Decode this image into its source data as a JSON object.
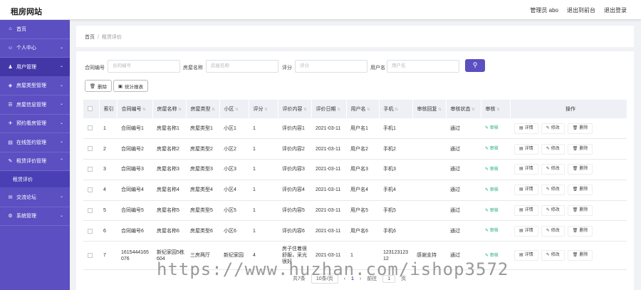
{
  "header": {
    "brand": "租房网站",
    "user_label": "管理员 abo",
    "front_link": "退出到前台",
    "logout_link": "退出登录"
  },
  "sidebar": {
    "items": [
      {
        "icon": "home-icon",
        "glyph": "⌂",
        "label": "首页",
        "chev": ""
      },
      {
        "icon": "person-icon",
        "glyph": "☺",
        "label": "个人中心",
        "chev": "⌄"
      },
      {
        "icon": "user-icon",
        "glyph": "♟",
        "label": "用户管理",
        "chev": "⌄"
      },
      {
        "icon": "category-icon",
        "glyph": "◈",
        "label": "房屋类型管理",
        "chev": "⌄"
      },
      {
        "icon": "list-icon",
        "glyph": "☰",
        "label": "房屋信息管理",
        "chev": "⌄"
      },
      {
        "icon": "appointment-icon",
        "glyph": "✈",
        "label": "预约看房管理",
        "chev": "⌄"
      },
      {
        "icon": "contract-icon",
        "glyph": "▤",
        "label": "在线签约管理",
        "chev": "⌄"
      },
      {
        "icon": "review-icon",
        "glyph": "✎",
        "label": "租赁评价管理",
        "chev": "⌃"
      },
      {
        "icon": "forum-icon",
        "glyph": "✉",
        "label": "交流论坛",
        "chev": "⌄"
      },
      {
        "icon": "system-icon",
        "glyph": "⚙",
        "label": "系统管理",
        "chev": "⌄"
      }
    ],
    "sub_item": "租赁评价"
  },
  "breadcrumb": {
    "home": "首页",
    "sep": "/",
    "current": "租赁评价"
  },
  "search": {
    "contract_label": "合同编号",
    "contract_placeholder": "合同编号",
    "house_label": "房屋名称",
    "house_placeholder": "房屋名称",
    "score_label": "评分",
    "score_placeholder": "评分",
    "user_label": "用户名",
    "user_placeholder": "用户名"
  },
  "toolbar": {
    "delete_label": "删除",
    "stats_label": "统计报表"
  },
  "table": {
    "headers": [
      "索引",
      "合同编号",
      "房屋名称",
      "房屋类型",
      "小区",
      "评分",
      "评价内容",
      "评价日期",
      "用户名",
      "手机",
      "审核回复",
      "审核状态",
      "审核",
      "操作"
    ],
    "audit_label": "审核",
    "op_detail": "详情",
    "op_edit": "修改",
    "op_delete": "删除",
    "rows": [
      [
        "1",
        "合同编号1",
        "房屋名称1",
        "房屋类型1",
        "小区1",
        "1",
        "评价内容1",
        "2021-03-11",
        "用户名1",
        "手机1",
        "",
        "通过"
      ],
      [
        "2",
        "合同编号2",
        "房屋名称2",
        "房屋类型2",
        "小区2",
        "1",
        "评价内容2",
        "2021-03-11",
        "用户名2",
        "手机2",
        "",
        "通过"
      ],
      [
        "3",
        "合同编号3",
        "房屋名称3",
        "房屋类型3",
        "小区3",
        "1",
        "评价内容3",
        "2021-03-11",
        "用户名3",
        "手机3",
        "",
        "通过"
      ],
      [
        "4",
        "合同编号4",
        "房屋名称4",
        "房屋类型4",
        "小区4",
        "1",
        "评价内容4",
        "2021-03-11",
        "用户名4",
        "手机4",
        "",
        "通过"
      ],
      [
        "5",
        "合同编号5",
        "房屋名称5",
        "房屋类型5",
        "小区5",
        "1",
        "评价内容5",
        "2021-03-11",
        "用户名5",
        "手机5",
        "",
        "通过"
      ],
      [
        "6",
        "合同编号6",
        "房屋名称6",
        "房屋类型6",
        "小区6",
        "1",
        "评价内容6",
        "2021-03-11",
        "用户名6",
        "手机6",
        "",
        "通过"
      ],
      [
        "7",
        "1615444165076",
        "新纪家园5栋604",
        "三房两厅",
        "新纪家园",
        "4",
        "房子住着很舒服，采光很好",
        "2021-03-11",
        "1",
        "12312312312",
        "感谢支持",
        "通过"
      ]
    ]
  },
  "pager": {
    "total": "共7条",
    "page_size": "10条/页",
    "page": "1",
    "goto_label": "前往",
    "goto_value": "1",
    "page_unit": "页"
  },
  "watermark": "https://www.huzhan.com/ishop3572",
  "colors": {
    "accent": "#5b4fc2",
    "audit": "#19a974"
  }
}
